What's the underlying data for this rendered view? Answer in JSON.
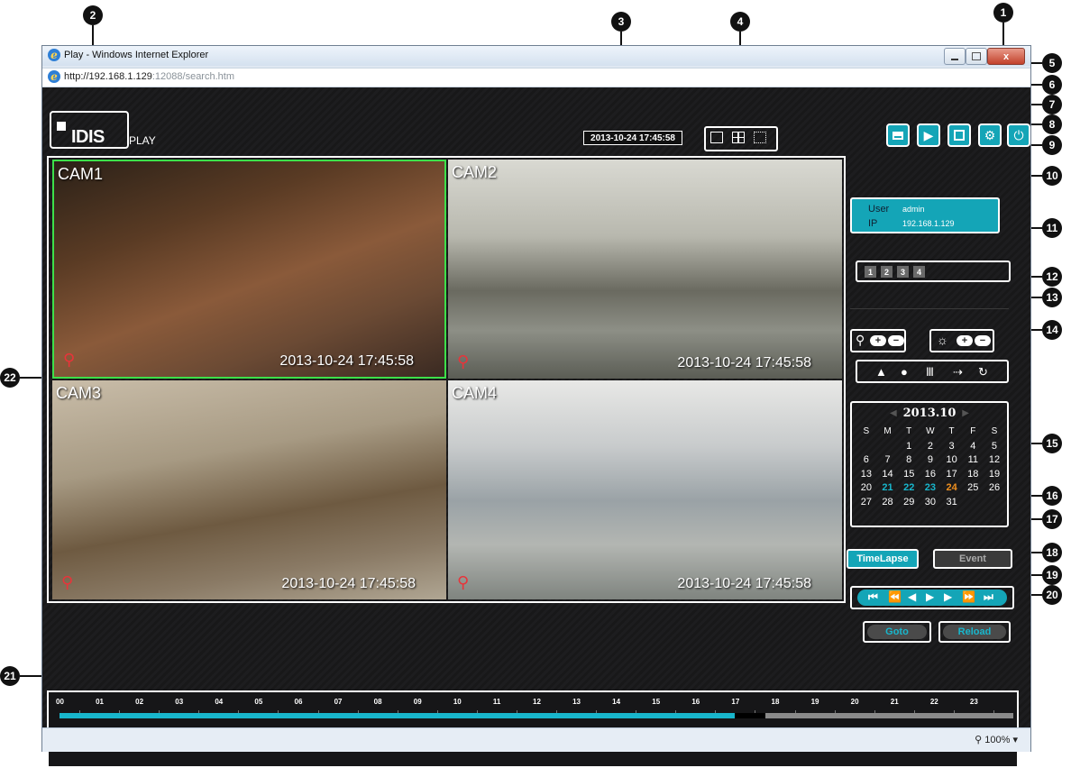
{
  "window": {
    "title": "Play - Windows Internet Explorer",
    "address_host": "http://192.168.1.129",
    "address_port_path": ":12088/search.htm",
    "minimize_icon": "minimize-icon",
    "maximize_icon": "maximize-icon",
    "close_label": "x"
  },
  "header": {
    "logo_text": "IDIS",
    "logo_sub": "PLAY",
    "datetime": "2013-10-24 17:45:58",
    "layout_buttons": [
      "single-layout-icon",
      "quad-layout-icon",
      "fullscreen-icon"
    ],
    "toolbar_buttons": [
      "print-icon",
      "playback-icon",
      "snapshot-icon",
      "settings-icon",
      "logout-icon"
    ]
  },
  "cameras": [
    {
      "name": "CAM1",
      "timestamp": "2013-10-24 17:45:58",
      "zoom_icon": "magnifier-icon"
    },
    {
      "name": "CAM2",
      "timestamp": "2013-10-24 17:45:58",
      "zoom_icon": "magnifier-icon"
    },
    {
      "name": "CAM3",
      "timestamp": "2013-10-24 17:45:58",
      "zoom_icon": "magnifier-icon"
    },
    {
      "name": "CAM4",
      "timestamp": "2013-10-24 17:45:58",
      "zoom_icon": "magnifier-icon"
    }
  ],
  "user_info": {
    "user_label": "User",
    "user_value": "admin",
    "ip_label": "IP",
    "ip_value": "192.168.1.129"
  },
  "camera_pages": [
    "1",
    "2",
    "3",
    "4"
  ],
  "zoom_control": {
    "icon": "zoom-icon",
    "plus": "+",
    "minus": "−"
  },
  "brightness_control": {
    "icon": "brightness-icon",
    "plus": "+",
    "minus": "−"
  },
  "image_controls": [
    "sharpness-icon",
    "blur-icon",
    "equalizer-icon",
    "interpolation-icon",
    "refresh-icon"
  ],
  "calendar": {
    "month": "2013.10",
    "prev_icon": "chevron-left-icon",
    "next_icon": "chevron-right-icon",
    "weekdays": [
      "S",
      "M",
      "T",
      "W",
      "T",
      "F",
      "S"
    ],
    "weeks": [
      [
        "",
        "",
        "1",
        "2",
        "3",
        "4",
        "5"
      ],
      [
        "6",
        "7",
        "8",
        "9",
        "10",
        "11",
        "12"
      ],
      [
        "13",
        "14",
        "15",
        "16",
        "17",
        "18",
        "19"
      ],
      [
        "20",
        "21",
        "22",
        "23",
        "24",
        "25",
        "26"
      ],
      [
        "27",
        "28",
        "29",
        "30",
        "31",
        "",
        ""
      ]
    ],
    "recorded_days": [
      "21",
      "22",
      "23"
    ],
    "selected_day": "24"
  },
  "search_modes": {
    "timelapse": "TimeLapse",
    "event": "Event"
  },
  "playback_buttons": [
    "skip-to-start-icon",
    "fast-rewind-icon",
    "step-back-icon",
    "play-icon",
    "step-forward-icon",
    "fast-forward-icon",
    "skip-to-end-icon"
  ],
  "actions": {
    "goto": "Goto",
    "reload": "Reload"
  },
  "timeline": {
    "hours": [
      "00",
      "01",
      "02",
      "03",
      "04",
      "05",
      "06",
      "07",
      "08",
      "09",
      "10",
      "11",
      "12",
      "13",
      "14",
      "15",
      "16",
      "17",
      "18",
      "19",
      "20",
      "21",
      "22",
      "23"
    ],
    "recorded_until_hour": 17,
    "cursor_hour_fraction": 17.76
  },
  "status_bar": {
    "zoom": "100%"
  },
  "callouts": [
    "1",
    "2",
    "3",
    "4",
    "5",
    "6",
    "7",
    "8",
    "9",
    "10",
    "11",
    "12",
    "13",
    "14",
    "15",
    "16",
    "17",
    "18",
    "19",
    "20",
    "21",
    "22"
  ],
  "colors": {
    "accent": "#14a5b7",
    "recorded": "#18b6cc",
    "selected_day": "#f0901e",
    "magnifier": "#e8343a"
  }
}
